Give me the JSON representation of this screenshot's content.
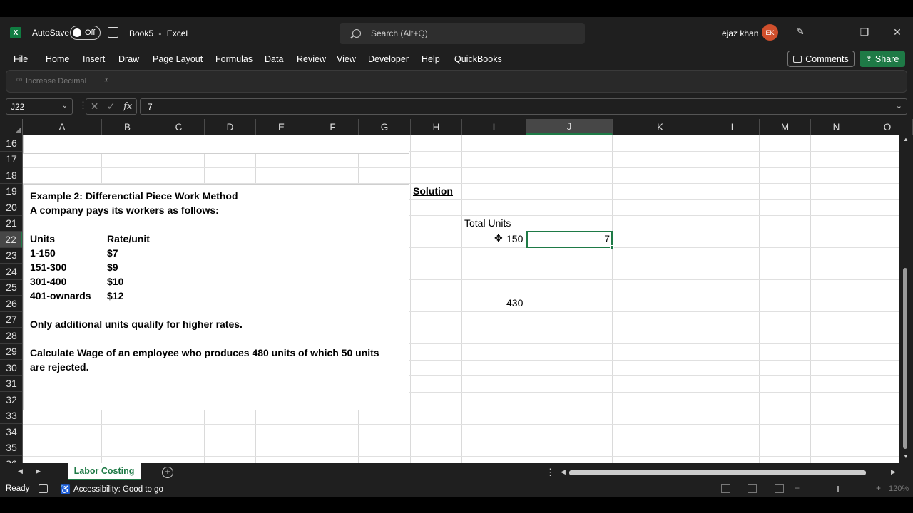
{
  "titlebar": {
    "app_badge": "X",
    "autosave_label": "AutoSave",
    "autosave_state": "Off",
    "document": "Book5",
    "separator": "-",
    "app": "Excel",
    "search_placeholder": "Search (Alt+Q)",
    "user_name": "ejaz khan",
    "user_initials": "EK"
  },
  "menu": [
    "File",
    "Home",
    "Insert",
    "Draw",
    "Page Layout",
    "Formulas",
    "Data",
    "Review",
    "View",
    "Developer",
    "Help",
    "QuickBooks"
  ],
  "buttons": {
    "comments": "Comments",
    "share": "Share"
  },
  "ribbon": {
    "command": "Increase Decimal"
  },
  "formula_bar": {
    "name_box": "J22",
    "formula": "7"
  },
  "columns": [
    "A",
    "B",
    "C",
    "D",
    "E",
    "F",
    "G",
    "H",
    "I",
    "J",
    "K",
    "L",
    "M",
    "N",
    "O"
  ],
  "active_column": "J",
  "rows": [
    "16",
    "17",
    "18",
    "19",
    "20",
    "21",
    "22",
    "23",
    "24",
    "25",
    "26",
    "27",
    "28",
    "29",
    "30",
    "31",
    "32",
    "33",
    "34",
    "35",
    "36"
  ],
  "active_row": "22",
  "textbox": {
    "title": "Example 2: Differenctial Piece Work Method",
    "subtitle": "A company pays its workers as follows:",
    "header": {
      "units": "Units",
      "rate": "Rate/unit"
    },
    "rates": [
      {
        "units": "1-150",
        "rate": "$7"
      },
      {
        "units": "151-300",
        "rate": "$9"
      },
      {
        "units": "301-400",
        "rate": "$10"
      },
      {
        "units": "401-ownards",
        "rate": "$12"
      }
    ],
    "note": "Only additional units qualify for higher rates.",
    "question_line1": "Calculate Wage of an employee who produces 480 units of which 50 units",
    "question_line2": "are rejected."
  },
  "cells": {
    "H19": "Solution",
    "I21": "Total Units",
    "I22": "150",
    "J22": "7",
    "I26": "430"
  },
  "sheet_tabs": [
    "Labor Costing"
  ],
  "status": {
    "ready": "Ready",
    "accessibility": "Accessibility: Good to go",
    "zoom": "120%"
  }
}
